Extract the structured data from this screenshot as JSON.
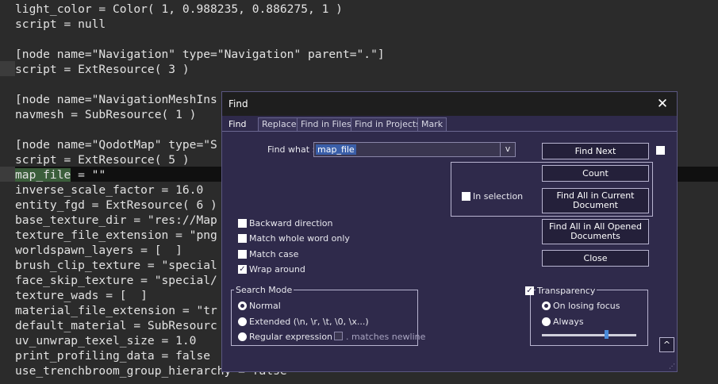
{
  "editor": {
    "lines": [
      {
        "text": "light_color = Color( 1, 0.988235, 0.886275, 1 )"
      },
      {
        "text": "script = null"
      },
      {
        "text": ""
      },
      {
        "text": "[node name=\"Navigation\" type=\"Navigation\" parent=\".\"]"
      },
      {
        "text": "script = ExtResource( 3 )"
      },
      {
        "text": ""
      },
      {
        "text": "[node name=\"NavigationMeshIns"
      },
      {
        "text": "navmesh = SubResource( 1 )"
      },
      {
        "text": ""
      },
      {
        "text": "[node name=\"QodotMap\" type=\"S"
      },
      {
        "text": "script = ExtResource( 5 )"
      },
      {
        "text": "map_file",
        "rest": " = \"\""
      },
      {
        "text": "inverse_scale_factor = 16.0"
      },
      {
        "text": "entity_fgd = ExtResource( 6 )"
      },
      {
        "text": "base_texture_dir = \"res://Map"
      },
      {
        "text": "texture_file_extension = \"png"
      },
      {
        "text": "worldspawn_layers = [  ]"
      },
      {
        "text": "brush_clip_texture = \"special"
      },
      {
        "text": "face_skip_texture = \"special/"
      },
      {
        "text": "texture_wads = [  ]"
      },
      {
        "text": "material_file_extension = \"tr"
      },
      {
        "text": "default_material = SubResourc"
      },
      {
        "text": "uv_unwrap_texel_size = 1.0"
      },
      {
        "text": "print_profiling_data = false"
      },
      {
        "text": "use_trenchbroom_group_hierarchy = false"
      }
    ]
  },
  "dialog": {
    "title": "Find",
    "tabs": [
      "Find",
      "Replace",
      "Find in Files",
      "Find in Projects",
      "Mark"
    ],
    "find_what_label": "Find what :",
    "find_what_value": "map_file",
    "dropdown_glyph": "v",
    "buttons": {
      "find_next": "Find Next",
      "count": "Count",
      "find_all_current": "Find All in Current Document",
      "find_all_opened": "Find All in All Opened Documents",
      "close": "Close"
    },
    "in_selection": "In selection",
    "options": {
      "backward": "Backward direction",
      "whole_word": "Match whole word only",
      "match_case": "Match case",
      "wrap_around": "Wrap around"
    },
    "search_mode": {
      "title": "Search Mode",
      "normal": "Normal",
      "extended": "Extended (\\n, \\r, \\t, \\0, \\x...)",
      "regex": "Regular expression",
      "matches_newline": ". matches newline"
    },
    "transparency": {
      "title": "Transparency",
      "on_losing_focus": "On losing focus",
      "always": "Always",
      "level": 0.68
    },
    "up_glyph": "^"
  },
  "colors": {
    "editor_bg": "#2b2b2b",
    "dialog_bg": "#2f2a4b",
    "selection": "#3a5ea8",
    "slider_thumb": "#4a8ad8"
  }
}
